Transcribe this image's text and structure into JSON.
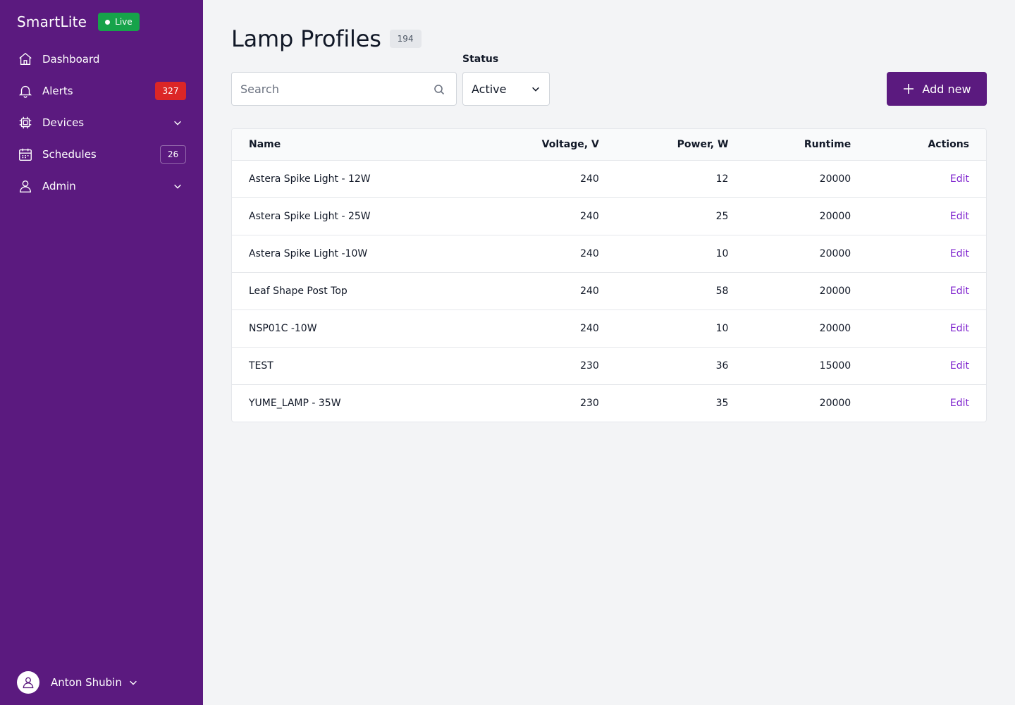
{
  "app": {
    "name": "SmartLite",
    "live_label": "Live",
    "colors": {
      "sidebar": "#5b1a7f",
      "accent": "#5b1a7f",
      "live": "#16a34a",
      "alert": "#dc2626",
      "link": "#7e22ce"
    }
  },
  "sidebar": {
    "items": [
      {
        "label": "Dashboard",
        "icon": "home-icon"
      },
      {
        "label": "Alerts",
        "icon": "bell-icon",
        "count": "327"
      },
      {
        "label": "Devices",
        "icon": "chip-icon",
        "expandable": true
      },
      {
        "label": "Schedules",
        "icon": "calendar-icon",
        "count": "26"
      },
      {
        "label": "Admin",
        "icon": "user-icon",
        "expandable": true
      }
    ],
    "user": {
      "name": "Anton Shubin",
      "icon": "user-avatar-icon"
    }
  },
  "main": {
    "title": "Lamp Profiles",
    "total": "194",
    "search": {
      "placeholder": "Search",
      "value": "",
      "icon": "search-icon"
    },
    "status": {
      "label": "Status",
      "value": "Active"
    },
    "add_button": {
      "label": "Add new",
      "icon": "plus-icon"
    },
    "table": {
      "columns": [
        "Name",
        "Voltage, V",
        "Power, W",
        "Runtime",
        "Actions"
      ],
      "rows": [
        {
          "name": "Astera Spike Light - 12W",
          "voltage": "240",
          "power": "12",
          "runtime": "20000",
          "action": "Edit"
        },
        {
          "name": "Astera Spike Light - 25W",
          "voltage": "240",
          "power": "25",
          "runtime": "20000",
          "action": "Edit"
        },
        {
          "name": "Astera Spike Light -10W",
          "voltage": "240",
          "power": "10",
          "runtime": "20000",
          "action": "Edit"
        },
        {
          "name": "Leaf Shape Post Top",
          "voltage": "240",
          "power": "58",
          "runtime": "20000",
          "action": "Edit"
        },
        {
          "name": "NSP01C -10W",
          "voltage": "240",
          "power": "10",
          "runtime": "20000",
          "action": "Edit"
        },
        {
          "name": "TEST",
          "voltage": "230",
          "power": "36",
          "runtime": "15000",
          "action": "Edit"
        },
        {
          "name": "YUME_LAMP - 35W",
          "voltage": "230",
          "power": "35",
          "runtime": "20000",
          "action": "Edit"
        }
      ]
    }
  }
}
